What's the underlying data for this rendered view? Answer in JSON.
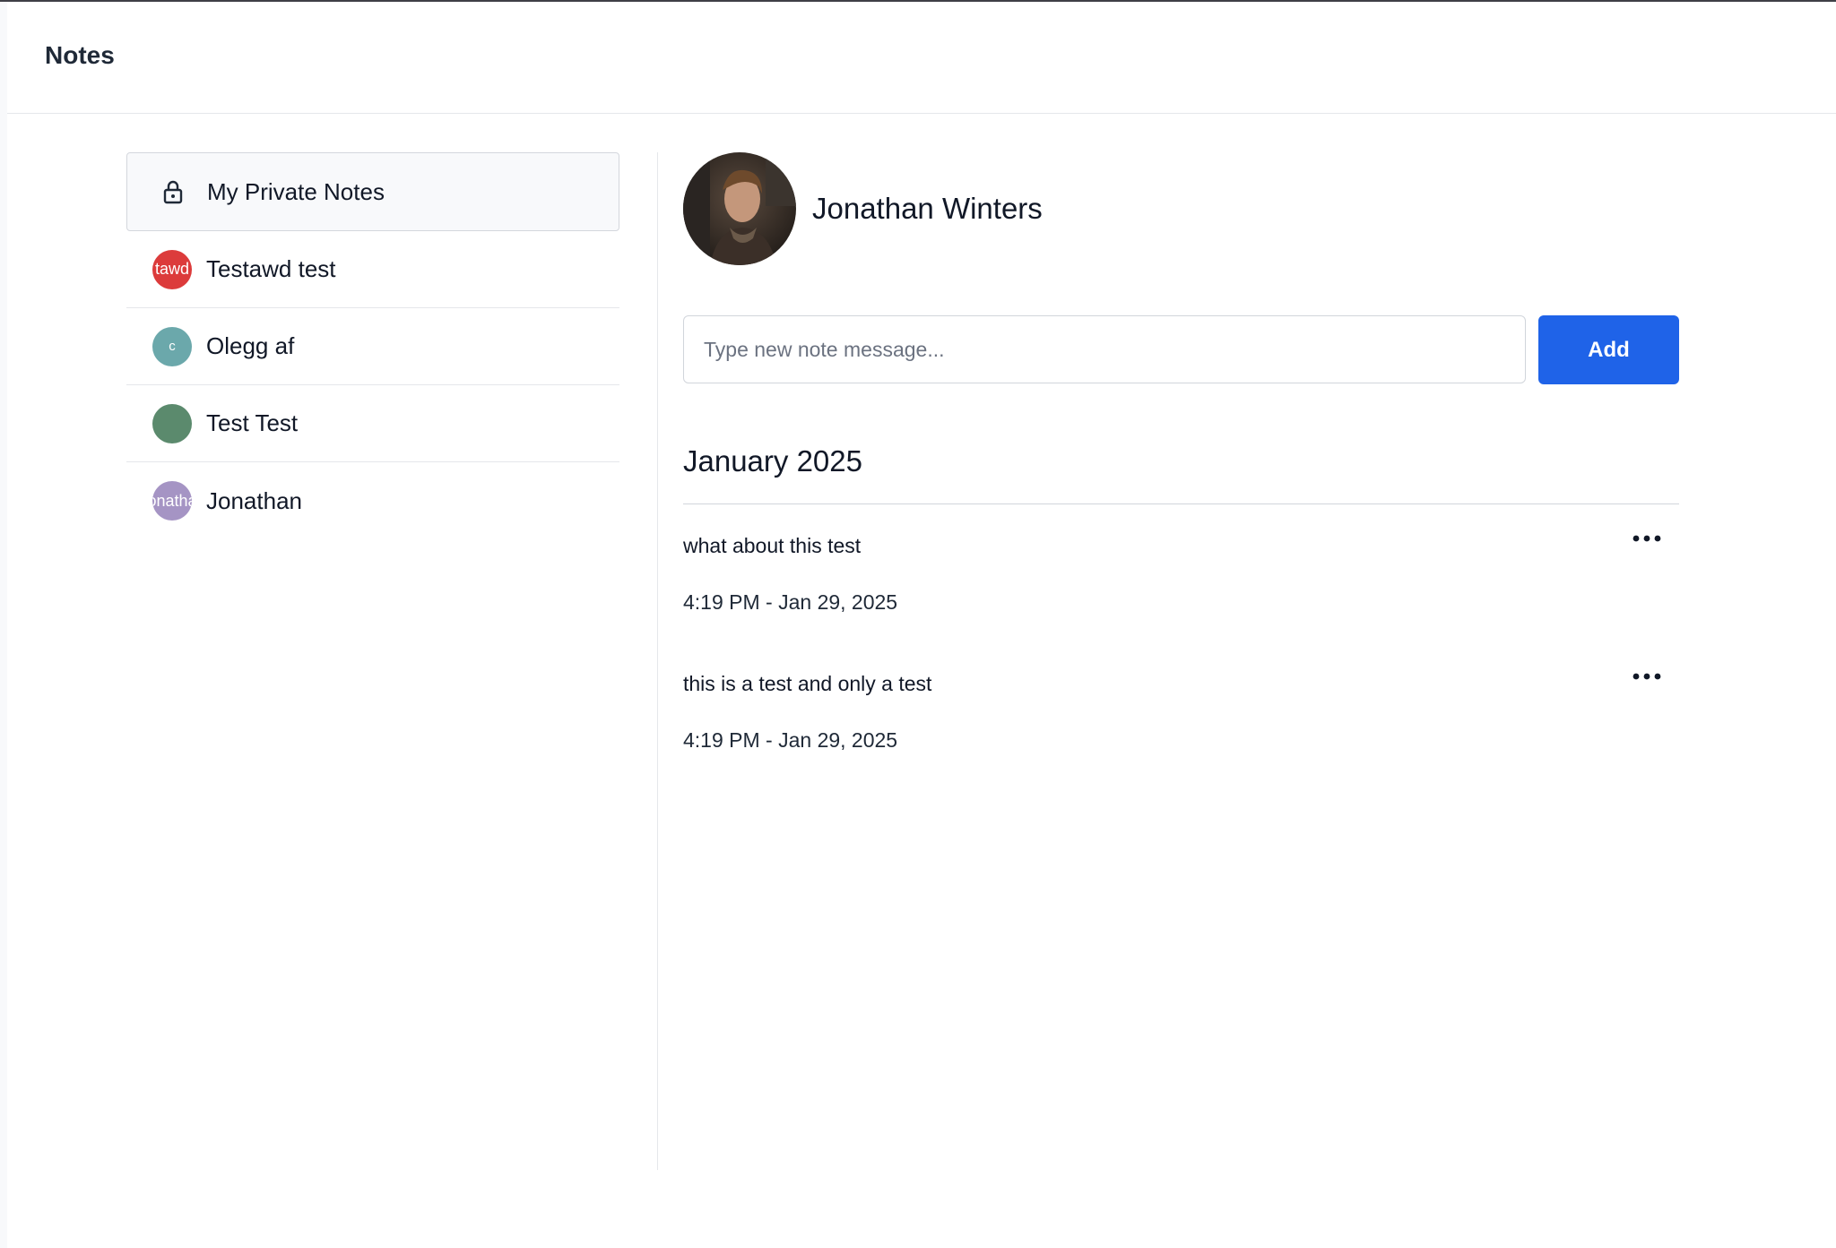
{
  "header": {
    "title": "Notes"
  },
  "sidebar": {
    "items": [
      {
        "label": "My Private Notes",
        "icon": "lock-icon",
        "active": true
      },
      {
        "label": "Testawd test",
        "avatar_text": "tawd",
        "avatar_color": "#dc3b3b"
      },
      {
        "label": "Olegg af",
        "avatar_text": "c",
        "avatar_color": "#6ba8ab"
      },
      {
        "label": "Test Test",
        "avatar_text": "",
        "avatar_color": "#5b8a6d"
      },
      {
        "label": "Jonathan",
        "avatar_text": "onatha",
        "avatar_color": "#a594c4"
      }
    ]
  },
  "profile": {
    "name": "Jonathan Winters"
  },
  "composer": {
    "placeholder": "Type new note message...",
    "value": "",
    "add_label": "Add"
  },
  "notes_section": {
    "month": "January 2025",
    "notes": [
      {
        "text": "what about this test",
        "time": "4:19 PM - Jan 29, 2025"
      },
      {
        "text": "this is a test and only a test",
        "time": "4:19 PM - Jan 29, 2025"
      }
    ]
  },
  "colors": {
    "accent": "#1f63e8",
    "border": "#e5e7eb"
  }
}
